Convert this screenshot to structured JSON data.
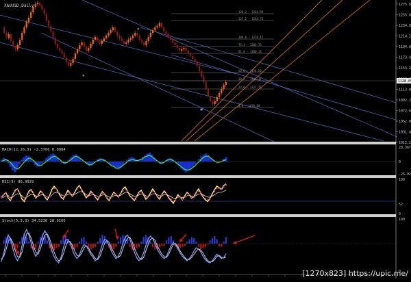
{
  "window": {
    "title": "XAUUSD,Daily"
  },
  "colors": {
    "background": "#000000",
    "bull_candle": "#ff6600",
    "bear_candle": "#8a1a1a",
    "channel": "#4a5aa8",
    "fibo_fan": "#c46a20",
    "fib_line": "#8a8a8a",
    "macd_hist": "#1a2dd0",
    "macd_signal": "#39e639",
    "rsi_line": "#ffff33",
    "rsi_magenta": "#e020e0",
    "stoch_main": "#7a9cff",
    "stoch_signal": "#d0d0d0",
    "arrow": "#e01515",
    "separator": "#cfcfcf"
  },
  "price_axis": {
    "ticks": [
      "1275.64",
      "1255.04",
      "1234.84",
      "1214.24",
      "1194.04",
      "1173.44",
      "1153.24",
      "1133.04",
      "1113.04",
      "1092.24",
      "1072.64",
      "1052.04",
      "1031.44",
      "1012.24"
    ],
    "current_price": "1128.09"
  },
  "fib_levels": [
    {
      "label": "138.2 - 1284.98"
    },
    {
      "label": "127.2 - 1248.73"
    },
    {
      "label": "100.0 - 1228.42"
    },
    {
      "label": "76.4 - 1202.76"
    },
    {
      "label": "61.8 - 1180.13"
    },
    {
      "label": "50.0 - 1154.50"
    },
    {
      "label": "38.2 - 1141.14"
    },
    {
      "label": "23.6 - 1127.71"
    },
    {
      "label": "0.0 - 1078.00"
    }
  ],
  "macd": {
    "label": "MACD(12,26,9) -2.5706 0.8984",
    "ticks": [
      "28.367",
      "0",
      "-25.025"
    ],
    "histogram": [
      2,
      4,
      3,
      -2,
      -6,
      -10,
      -12,
      -8,
      -3,
      2,
      5,
      7,
      6,
      3,
      -1,
      -4,
      -6,
      -5,
      -2,
      1,
      4,
      6,
      8,
      9,
      7,
      4,
      1,
      -2,
      -3,
      -1,
      2,
      5,
      7,
      8,
      6,
      3,
      1,
      -1,
      -3,
      -5,
      -4,
      -2,
      1,
      3,
      4,
      3,
      2,
      0,
      -2,
      -4,
      -6,
      -8,
      -9,
      -7,
      -4,
      -1,
      2,
      4,
      5,
      4,
      2,
      1,
      3,
      5,
      7,
      9,
      10,
      8,
      5,
      2,
      -1,
      -3,
      -2,
      1,
      3,
      4,
      3,
      1,
      -2,
      -5,
      -8,
      -10,
      -12,
      -11,
      -9,
      -6,
      -3,
      0,
      3,
      6,
      8,
      9,
      7,
      4,
      2,
      0,
      -2,
      -1,
      1,
      3,
      5
    ],
    "signal": [
      1,
      2,
      3,
      2,
      0,
      -3,
      -6,
      -8,
      -7,
      -4,
      -1,
      2,
      4,
      5,
      3,
      1,
      -2,
      -4,
      -4,
      -2,
      0,
      2,
      4,
      6,
      7,
      6,
      4,
      2,
      0,
      -1,
      0,
      2,
      4,
      6,
      7,
      6,
      4,
      2,
      0,
      -2,
      -3,
      -3,
      -1,
      1,
      2,
      3,
      3,
      2,
      0,
      -2,
      -4,
      -5,
      -7,
      -7,
      -6,
      -4,
      -2,
      0,
      2,
      3,
      3,
      2,
      2,
      3,
      4,
      6,
      7,
      8,
      7,
      5,
      3,
      1,
      -1,
      -1,
      0,
      2,
      3,
      3,
      2,
      0,
      -2,
      -4,
      -6,
      -8,
      -9,
      -9,
      -8,
      -6,
      -4,
      -1,
      1,
      4,
      6,
      7,
      7,
      5,
      3,
      1,
      0,
      0,
      1,
      2,
      3
    ]
  },
  "rsi": {
    "label": "RSI(9) 86.9929",
    "ticks": [
      "100",
      "52",
      "0"
    ],
    "yellow": [
      48,
      55,
      62,
      45,
      38,
      55,
      68,
      72,
      60,
      42,
      35,
      50,
      65,
      70,
      58,
      45,
      52,
      66,
      60,
      48,
      40,
      52,
      70,
      80,
      72,
      60,
      48,
      42,
      55,
      68,
      60,
      50,
      62,
      75,
      82,
      70,
      58,
      46,
      52,
      65,
      58,
      48,
      40,
      52,
      64,
      58,
      45,
      38,
      50,
      62,
      56,
      48,
      58,
      72,
      78,
      65,
      52,
      45,
      38,
      50,
      62,
      68,
      55,
      42,
      48,
      60,
      72,
      62,
      50,
      42,
      55,
      66,
      58,
      46,
      38,
      30,
      42,
      55,
      48,
      40,
      52,
      62,
      56,
      45,
      50,
      62,
      72,
      60,
      48,
      40,
      35,
      45,
      58,
      70,
      80,
      76,
      70,
      82,
      87
    ],
    "magenta_dots": [
      50,
      54,
      60,
      52,
      42,
      52,
      64,
      70,
      62,
      48,
      40,
      48,
      60,
      66,
      60,
      48,
      50,
      62,
      60,
      50,
      44,
      50,
      64,
      74,
      72,
      62,
      52,
      46,
      52,
      62,
      60,
      52,
      58,
      70,
      78,
      72,
      62,
      50,
      50,
      60,
      58,
      50,
      44,
      50,
      60,
      58,
      48,
      42,
      48,
      58,
      56,
      50,
      56,
      66,
      72,
      66,
      56,
      48,
      42,
      48,
      58,
      64,
      58,
      48,
      48,
      56,
      66,
      62,
      52,
      46,
      52,
      62,
      58,
      50,
      42,
      36,
      40,
      50,
      48,
      42,
      48,
      58,
      56,
      48,
      48,
      58,
      66,
      62,
      52,
      44,
      40,
      44,
      54,
      64,
      74,
      74,
      70,
      78,
      84
    ],
    "white": [
      45,
      48,
      52,
      50,
      46,
      48,
      54,
      58,
      56,
      52,
      46,
      46,
      52,
      56,
      55,
      52,
      50,
      54,
      55,
      52,
      48,
      48,
      54,
      60,
      62,
      60,
      56,
      52,
      52,
      56,
      57,
      55,
      56,
      60,
      64,
      64,
      60,
      55,
      52,
      54,
      55,
      53,
      50,
      50,
      54,
      55,
      52,
      48,
      48,
      52,
      53,
      52,
      53,
      58,
      62,
      62,
      58,
      54,
      50,
      50,
      54,
      57,
      56,
      52,
      51,
      54,
      58,
      58,
      55,
      52,
      52,
      55,
      55,
      53,
      49,
      45,
      45,
      48,
      48,
      47,
      48,
      52,
      53,
      51,
      50,
      53,
      57,
      58,
      55,
      51,
      48,
      48,
      51,
      55,
      60,
      62,
      62,
      65,
      68
    ]
  },
  "stoch": {
    "label": "Stoch(5,3,3) 34.5236 28.9165",
    "ticks": [
      "100",
      "0"
    ],
    "main": [
      20,
      35,
      55,
      70,
      62,
      45,
      30,
      22,
      30,
      50,
      72,
      80,
      70,
      55,
      40,
      30,
      38,
      55,
      70,
      78,
      70,
      56,
      40,
      30,
      22,
      18,
      28,
      45,
      60,
      62,
      55,
      42,
      32,
      26,
      32,
      44,
      52,
      50,
      42,
      34,
      28,
      22,
      26,
      38,
      52,
      62,
      60,
      50,
      40,
      32,
      26,
      30,
      40,
      55,
      66,
      70,
      62,
      50,
      38,
      28,
      22,
      26,
      36,
      50,
      62,
      68,
      64,
      54,
      44,
      36,
      30,
      26,
      30,
      40,
      50,
      56,
      52,
      44,
      36,
      30,
      26,
      22,
      26,
      32,
      40,
      46,
      44,
      38,
      30,
      24,
      20,
      18,
      22,
      28,
      34,
      30,
      26,
      28,
      35
    ],
    "signal": [
      25,
      30,
      42,
      58,
      64,
      56,
      42,
      30,
      28,
      38,
      56,
      72,
      74,
      64,
      50,
      38,
      34,
      44,
      58,
      70,
      72,
      64,
      50,
      38,
      28,
      22,
      24,
      34,
      48,
      58,
      58,
      50,
      40,
      32,
      30,
      36,
      46,
      50,
      46,
      38,
      32,
      26,
      24,
      30,
      42,
      54,
      60,
      56,
      46,
      38,
      30,
      28,
      32,
      44,
      56,
      64,
      66,
      58,
      46,
      36,
      28,
      24,
      28,
      40,
      52,
      62,
      64,
      60,
      50,
      42,
      34,
      30,
      28,
      34,
      44,
      52,
      54,
      48,
      40,
      34,
      28,
      24,
      24,
      28,
      34,
      40,
      44,
      42,
      36,
      28,
      22,
      20,
      20,
      24,
      30,
      32,
      28,
      27,
      29
    ],
    "histogram": [
      0,
      3,
      6,
      8,
      5,
      -3,
      -6,
      -4,
      2,
      6,
      9,
      6,
      2,
      -4,
      -6,
      -5,
      2,
      6,
      8,
      7,
      3,
      -4,
      -7,
      -6,
      -4,
      -3,
      3,
      7,
      8,
      4,
      -2,
      -5,
      -5,
      -3,
      2,
      5,
      6,
      2,
      -3,
      -5,
      -4,
      -3,
      2,
      5,
      8,
      7,
      2,
      -4,
      -6,
      -5,
      -3,
      2,
      6,
      8,
      7,
      4,
      -3,
      -6,
      -6,
      -4,
      -3,
      2,
      6,
      8,
      6,
      2,
      -3,
      -5,
      -6,
      -3,
      -2,
      -2,
      3,
      6,
      7,
      3,
      -3,
      -5,
      -4,
      -3,
      -2,
      2,
      4,
      6,
      5,
      2,
      -3,
      -5,
      -4,
      -3,
      -1,
      3,
      5,
      7,
      4,
      -2,
      -3,
      2,
      6
    ]
  },
  "watermark": "[1270x823] https://upic.me/"
}
